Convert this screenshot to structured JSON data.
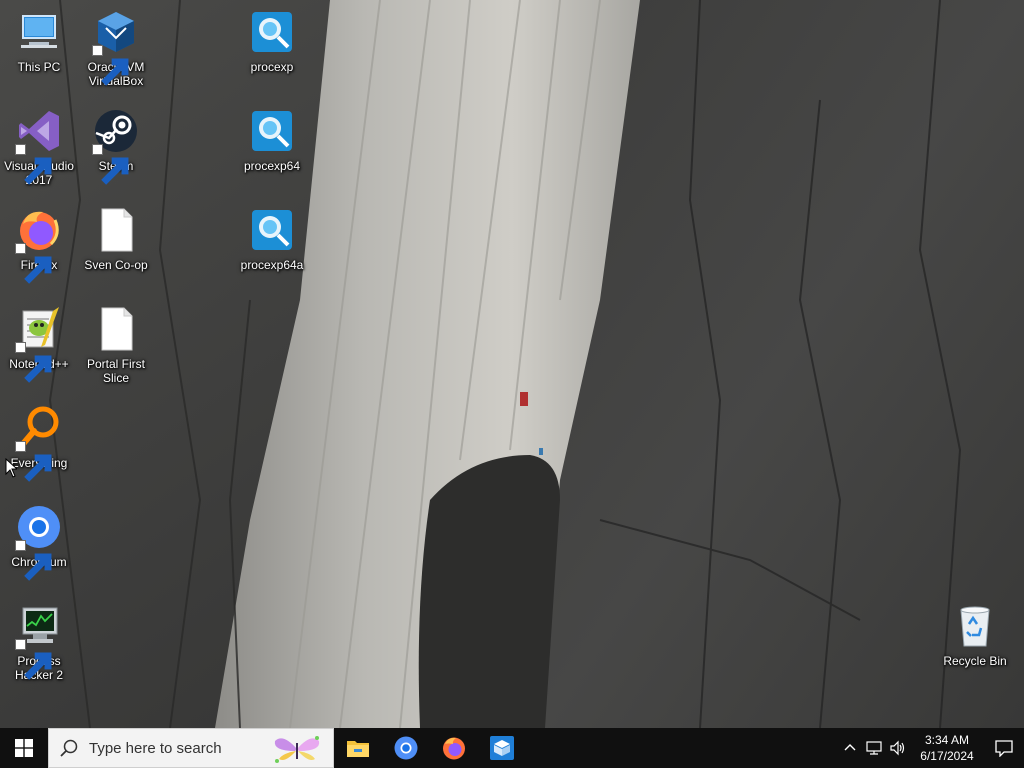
{
  "desktop": {
    "icons": [
      {
        "label": "This PC"
      },
      {
        "label": "Oracle VM VirtualBox"
      },
      {
        "label": "procexp"
      },
      {
        "label": "Visual Studio 2017"
      },
      {
        "label": "Steam"
      },
      {
        "label": "procexp64"
      },
      {
        "label": "Firefox"
      },
      {
        "label": "Sven Co-op"
      },
      {
        "label": "procexp64a"
      },
      {
        "label": "Notepad++"
      },
      {
        "label": "Portal First Slice"
      },
      {
        "label": "Everything"
      },
      {
        "label": "Chromium"
      },
      {
        "label": "Process Hacker 2"
      },
      {
        "label": "Recycle Bin"
      }
    ]
  },
  "taskbar": {
    "search_placeholder": "Type here to search",
    "apps": [
      "File Explorer",
      "Chromium",
      "Firefox",
      "Oracle VM VirtualBox"
    ],
    "clock": {
      "time": "3:34 AM",
      "date": "6/17/2024"
    }
  },
  "colors": {
    "taskbar_bg": "#101010",
    "search_bg": "#f3f3f3",
    "start_icon": "#ffffff"
  }
}
